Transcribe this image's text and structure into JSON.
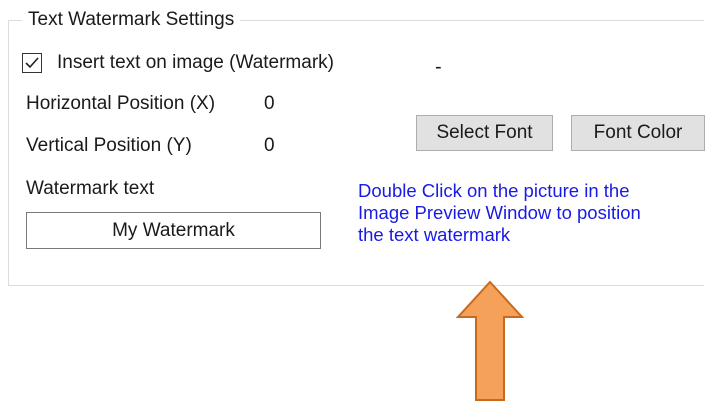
{
  "group": {
    "title": "Text Watermark Settings"
  },
  "watermark": {
    "checkbox_label": "Insert text on image (Watermark)",
    "checked": true,
    "dash": "-",
    "horizontal_label": "Horizontal Position (X)",
    "horizontal_value": "0",
    "vertical_label": "Vertical Position (Y)",
    "vertical_value": "0",
    "text_label": "Watermark text",
    "text_value": "My Watermark"
  },
  "buttons": {
    "select_font": "Select Font",
    "font_color": "Font Color"
  },
  "hint": {
    "lines": [
      "Double Click on the picture in the",
      "Image Preview Window to position",
      "the text watermark"
    ],
    "color": "#1a1ae6"
  },
  "annotation": {
    "arrow_icon": "up-arrow-icon",
    "arrow_fill": "#f5a15a",
    "arrow_stroke": "#c86a1e"
  }
}
